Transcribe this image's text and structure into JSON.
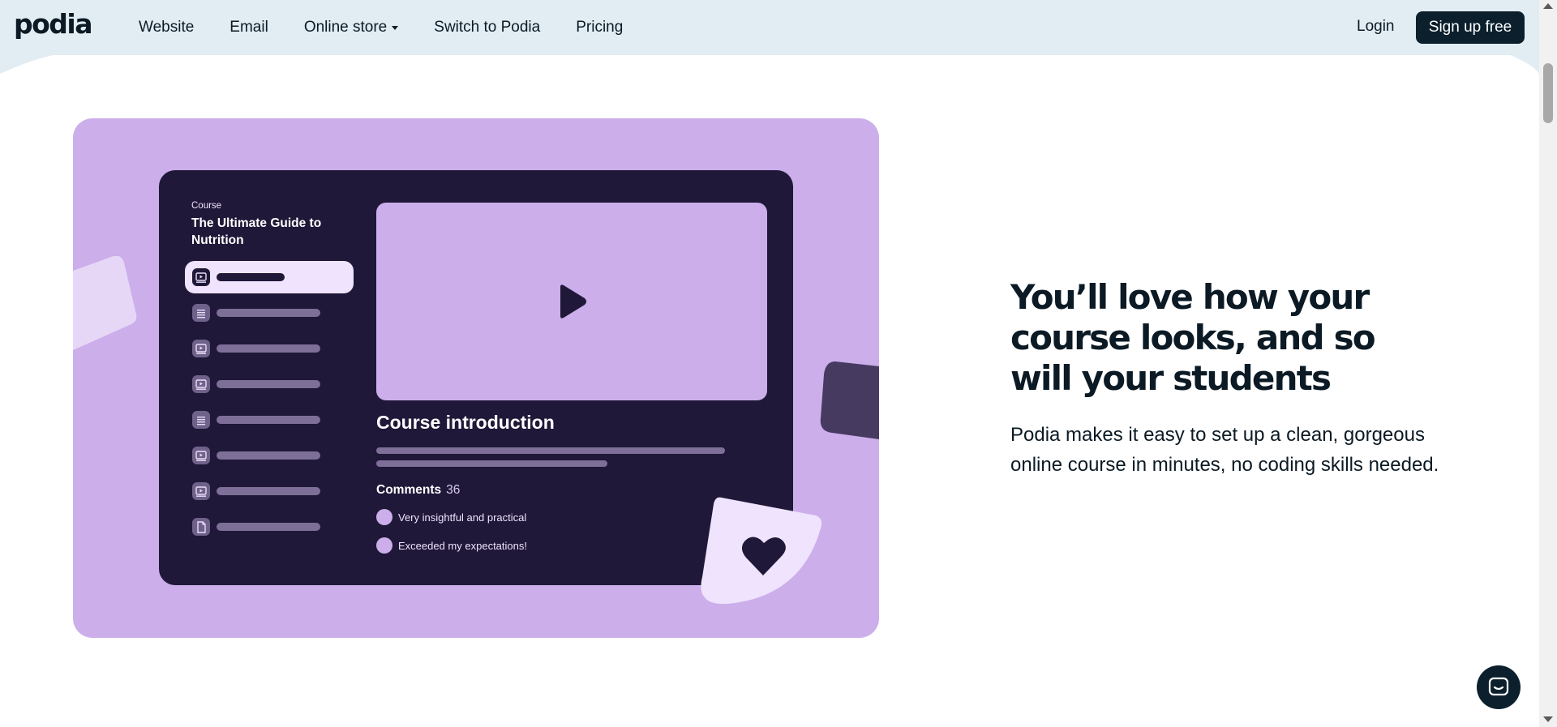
{
  "header": {
    "logo": "podia",
    "nav": [
      {
        "label": "Website"
      },
      {
        "label": "Email"
      },
      {
        "label": "Online store",
        "has_dropdown": true
      },
      {
        "label": "Switch to Podia"
      },
      {
        "label": "Pricing"
      }
    ],
    "login": "Login",
    "signup": "Sign up free"
  },
  "hero": {
    "mockup": {
      "course_caption": "Course",
      "course_title": "The Ultimate Guide to Nutrition",
      "lesson_icons": [
        "video-icon",
        "text-icon",
        "video-icon",
        "video-icon",
        "text-icon",
        "video-icon",
        "video-icon",
        "document-icon"
      ],
      "active_lesson_index": 0,
      "video_title": "Course introduction",
      "comments_label": "Comments",
      "comments_count": "36",
      "comments": [
        "Very insightful and practical",
        "Exceeded my expectations!"
      ]
    },
    "headline": "You’ll love how your course looks, and so will your students",
    "subcopy": "Podia makes it easy to set up a clean, gorgeous online course in minutes, no coding skills needed."
  },
  "chat_button_icon": "chat-icon",
  "colors": {
    "header_bg": "#e1ecf3",
    "card_bg": "#cbaeea",
    "window_bg": "#1f1838",
    "highlight": "#efe3fd",
    "text_dark": "#0b1a24",
    "button_dark": "#0b1f2c"
  }
}
